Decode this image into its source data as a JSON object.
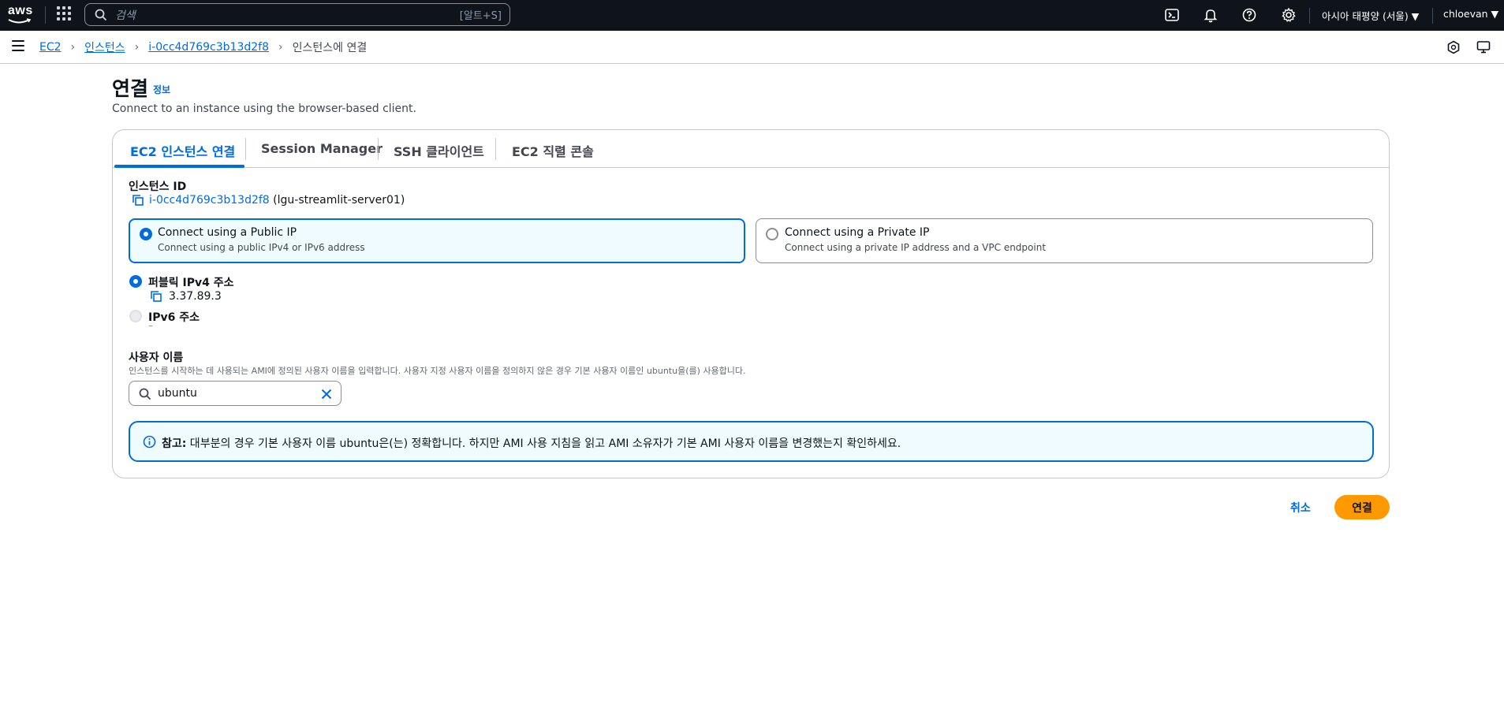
{
  "topnav": {
    "logo_text": "aws",
    "search_placeholder": "검색",
    "search_shortcut": "[알트+S]",
    "region": "아시아 태평양 (서울) ▼",
    "user": "chloevan ▼",
    "icons": [
      "cloudshell-icon",
      "bell-icon",
      "help-icon",
      "settings-icon"
    ]
  },
  "breadcrumb": {
    "items": [
      "EC2",
      "인스턴스",
      "i-0cc4d769c3b13d2f8"
    ],
    "current": "인스턴스에 연결",
    "separator": "›"
  },
  "header": {
    "title": "연결",
    "info_link": "정보",
    "subtitle": "Connect to an instance using the browser-based client."
  },
  "tabs": [
    {
      "label": "EC2 인스턴스 연결",
      "active": true
    },
    {
      "label": "Session Manager",
      "active": false
    },
    {
      "label": "SSH 클라이언트",
      "active": false
    },
    {
      "label": "EC2 직렬 콘솔",
      "active": false
    }
  ],
  "instance": {
    "label": "인스턴스 ID",
    "id": "i-0cc4d769c3b13d2f8",
    "name": "(lgu-streamlit-server01)"
  },
  "connection_options": [
    {
      "title": "Connect using a Public IP",
      "desc": "Connect using a public IPv4 or IPv6 address",
      "selected": true
    },
    {
      "title": "Connect using a Private IP",
      "desc": "Connect using a private IP address and a VPC endpoint",
      "selected": false
    }
  ],
  "addresses": {
    "ipv4_label": "퍼블릭 IPv4 주소",
    "ipv4_value": "3.37.89.3",
    "ipv6_label": "IPv6 주소",
    "ipv6_value": "–"
  },
  "username": {
    "label": "사용자 이름",
    "desc": "인스턴스를 시작하는 데 사용되는 AMI에 정의된 사용자 이름을 입력합니다. 사용자 지정 사용자 이름을 정의하지 않은 경우 기본 사용자 이름인 ubuntu을(를) 사용합니다.",
    "value": "ubuntu"
  },
  "alert": {
    "bold": "참고:",
    "text": " 대부분의 경우 기본 사용자 이름 ubuntu은(는) 정확합니다. 하지만 AMI 사용 지침을 읽고 AMI 소유자가 기본 AMI 사용자 이름을 변경했는지 확인하세요."
  },
  "actions": {
    "cancel": "취소",
    "connect": "연결"
  },
  "colors": {
    "nav_bg": "#0f141a",
    "link": "#006ce0",
    "primary_button": "#ff9900",
    "selected_bg": "#f0fbff"
  }
}
